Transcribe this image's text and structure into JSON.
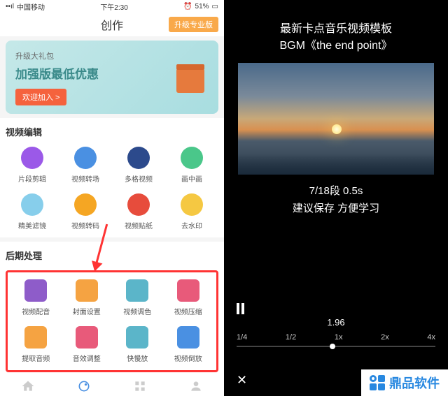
{
  "status": {
    "carrier": "中国移动",
    "time": "下午2:30",
    "alarm": "⏰",
    "battery": "51%"
  },
  "header": {
    "title": "创作",
    "upgrade": "升级专业版"
  },
  "promo": {
    "subtitle": "升级大礼包",
    "title": "加强版最低优惠",
    "join": "欢迎加入 >"
  },
  "section1": {
    "title": "视频编辑",
    "items": [
      {
        "label": "片段剪辑",
        "icon": "icon-purple"
      },
      {
        "label": "视频转场",
        "icon": "icon-blue"
      },
      {
        "label": "多格视频",
        "icon": "icon-darkblue"
      },
      {
        "label": "画中画",
        "icon": "icon-green"
      },
      {
        "label": "精美滤镜",
        "icon": "icon-lightblue"
      },
      {
        "label": "视频转码",
        "icon": "icon-orange"
      },
      {
        "label": "视频贴纸",
        "icon": "icon-red"
      },
      {
        "label": "去水印",
        "icon": "icon-yellow"
      }
    ]
  },
  "section2": {
    "title": "后期处理",
    "items": [
      {
        "label": "视频配音",
        "icon": "icon-purple2"
      },
      {
        "label": "封面设置",
        "icon": "icon-orange2"
      },
      {
        "label": "视频调色",
        "icon": "icon-teal"
      },
      {
        "label": "视频压缩",
        "icon": "icon-pink"
      },
      {
        "label": "提取音频",
        "icon": "icon-headphone"
      },
      {
        "label": "音效调整",
        "icon": "icon-eq"
      },
      {
        "label": "快慢放",
        "icon": "icon-speed"
      },
      {
        "label": "视频倒放",
        "icon": "icon-reverse"
      }
    ]
  },
  "right": {
    "title_line1": "最新卡点音乐视频模板",
    "title_line2": "BGM《the end point》",
    "segment": "7/18段   0.5s",
    "hint": "建议保存     方便学习",
    "time_value": "1.96",
    "speeds": [
      "1/4",
      "1/2",
      "1x",
      "2x",
      "4x"
    ],
    "close": "✕"
  },
  "brand": "鼎品软件"
}
